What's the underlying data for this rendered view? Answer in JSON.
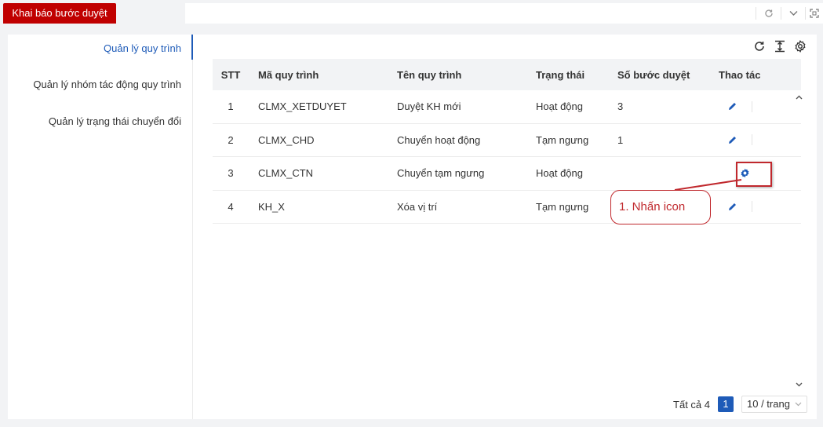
{
  "tabs": {
    "active_label": "Khai báo bước duyệt"
  },
  "topbar": {
    "icons": [
      "refresh-icon",
      "chevron-down-icon",
      "fullscreen-icon"
    ]
  },
  "sidebar": {
    "items": [
      {
        "label": "Quản lý quy trình",
        "active": true
      },
      {
        "label": "Quản lý nhóm tác động quy trình",
        "active": false
      },
      {
        "label": "Quản lý trạng thái chuyển đổi",
        "active": false
      }
    ]
  },
  "toolbar": {
    "icons": [
      "refresh-icon",
      "column-height-icon",
      "settings-icon"
    ]
  },
  "table": {
    "headers": [
      "STT",
      "Mã quy trình",
      "Tên quy trình",
      "Trạng thái",
      "Số bước duyệt",
      "Thao tác"
    ],
    "rows": [
      {
        "stt": "1",
        "code": "CLMX_XETDUYET",
        "name": "Duyệt KH mới",
        "status": "Hoạt động",
        "steps": "3",
        "action_icon": "edit-icon"
      },
      {
        "stt": "2",
        "code": "CLMX_CHD",
        "name": "Chuyển hoạt động",
        "status": "Tạm ngưng",
        "steps": "1",
        "action_icon": "edit-icon"
      },
      {
        "stt": "3",
        "code": "CLMX_CTN",
        "name": "Chuyển tạm ngưng",
        "status": "Hoạt động",
        "steps": "",
        "action_icon": "settings-icon"
      },
      {
        "stt": "4",
        "code": "KH_X",
        "name": "Xóa vị trí",
        "status": "Tạm ngưng",
        "steps": "",
        "action_icon": "edit-icon"
      }
    ]
  },
  "pagination": {
    "total_label": "Tất cả 4",
    "current_page": "1",
    "page_size_label": "10 / trang"
  },
  "annotation": {
    "callout_text": "1. Nhấn icon"
  },
  "colors": {
    "accent": "#1e5bb8",
    "tab_red": "#c00000",
    "annotation_red": "#c0282d"
  }
}
